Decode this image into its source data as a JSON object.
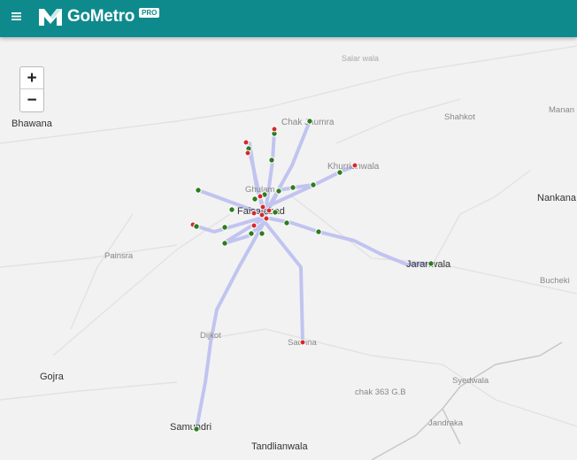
{
  "header": {
    "brand_name": "GoMetro",
    "badge": "PRO",
    "menu_icon": "hamburger-icon",
    "background": "#0e8a8d"
  },
  "zoom": {
    "in_label": "+",
    "out_label": "−"
  },
  "places": [
    {
      "name": "Salar wala",
      "minor": true
    },
    {
      "name": "Bhawana",
      "minor": false
    },
    {
      "name": "Chak Jhumra",
      "minor": true
    },
    {
      "name": "Shahkot",
      "minor": true
    },
    {
      "name": "Manan",
      "minor": true
    },
    {
      "name": "Khurrianwala",
      "minor": true
    },
    {
      "name": "Nankana",
      "minor": false
    },
    {
      "name": "Ghulam",
      "minor": true
    },
    {
      "name": "Faisalabad",
      "minor": false
    },
    {
      "name": "Painsra",
      "minor": true
    },
    {
      "name": "Jaranwala",
      "minor": false
    },
    {
      "name": "Bucheki",
      "minor": true
    },
    {
      "name": "Dijkot",
      "minor": true
    },
    {
      "name": "Sadhna",
      "minor": true
    },
    {
      "name": "Gojra",
      "minor": false
    },
    {
      "name": "chak 363 G.B",
      "minor": true
    },
    {
      "name": "Syedwala",
      "minor": true
    },
    {
      "name": "Jandraka",
      "minor": true
    },
    {
      "name": "Samundri",
      "minor": false
    },
    {
      "name": "Tandlianwala",
      "minor": false
    }
  ],
  "stop_colors": {
    "active": "#2d7d1f",
    "alert": "#d42a2a",
    "route": "#b9bcf0"
  }
}
